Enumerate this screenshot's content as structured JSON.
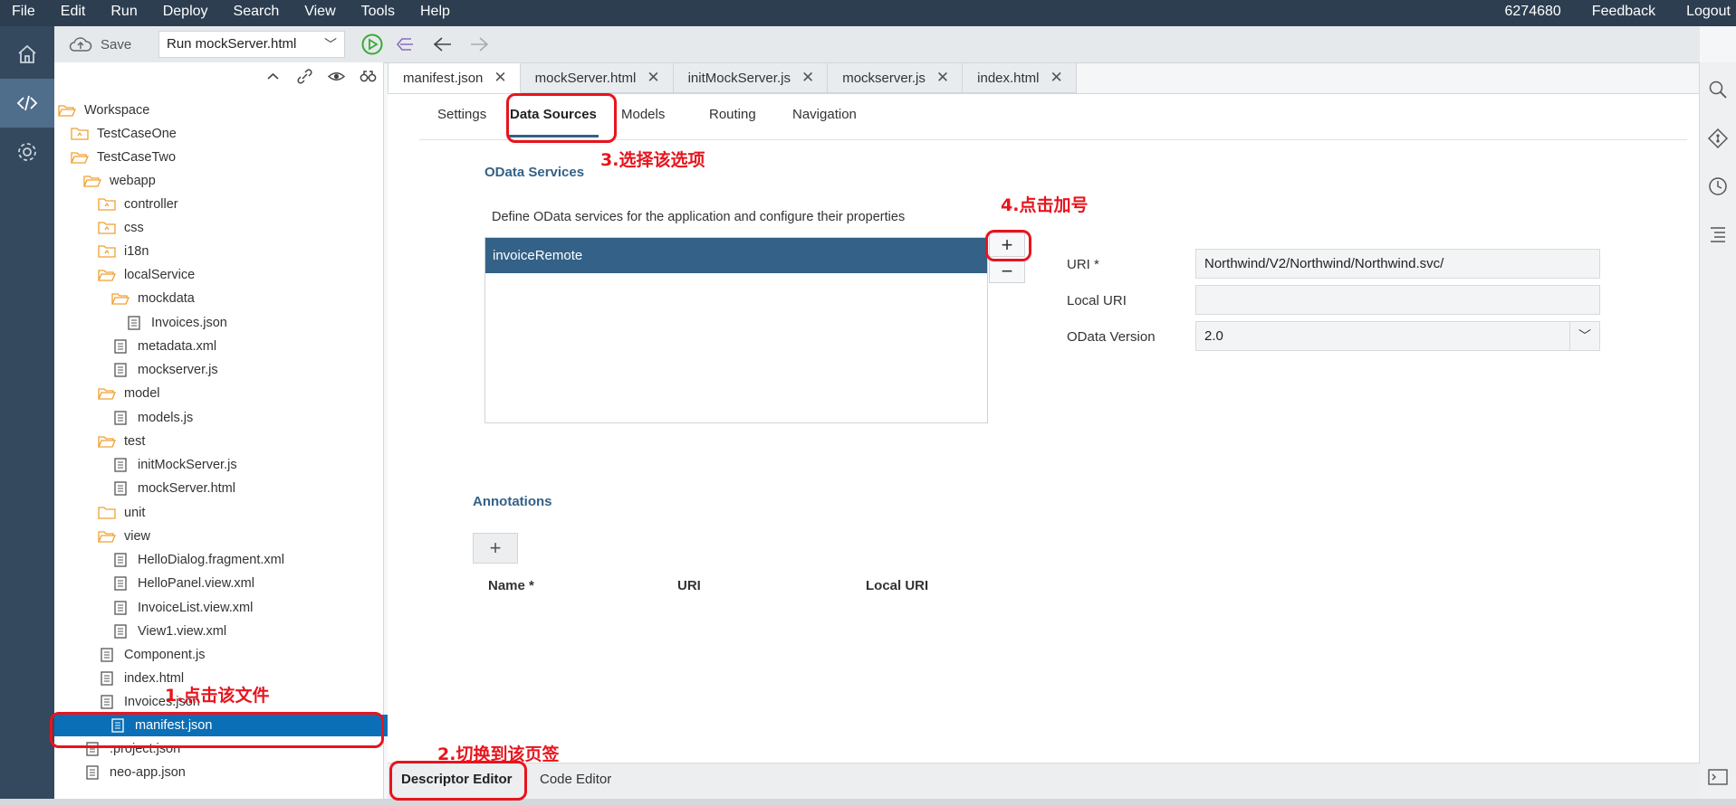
{
  "menubar": {
    "items": [
      "File",
      "Edit",
      "Run",
      "Deploy",
      "Search",
      "View",
      "Tools",
      "Help"
    ],
    "user": "6274680",
    "feedback": "Feedback",
    "logout": "Logout"
  },
  "toolbar": {
    "save_label": "Save",
    "run_config": "Run mockServer.html"
  },
  "explorer": {
    "tree": [
      {
        "label": "Workspace",
        "type": "folder-open",
        "indent": 0
      },
      {
        "label": "TestCaseOne",
        "type": "project",
        "indent": 1
      },
      {
        "label": "TestCaseTwo",
        "type": "folder-open",
        "indent": 1
      },
      {
        "label": "webapp",
        "type": "folder-open",
        "indent": 2
      },
      {
        "label": "controller",
        "type": "project",
        "indent": 3
      },
      {
        "label": "css",
        "type": "project",
        "indent": 3
      },
      {
        "label": "i18n",
        "type": "project",
        "indent": 3
      },
      {
        "label": "localService",
        "type": "folder-open",
        "indent": 3
      },
      {
        "label": "mockdata",
        "type": "folder-open",
        "indent": 4
      },
      {
        "label": "Invoices.json",
        "type": "file",
        "indent": 5
      },
      {
        "label": "metadata.xml",
        "type": "file",
        "indent": 4
      },
      {
        "label": "mockserver.js",
        "type": "file",
        "indent": 4
      },
      {
        "label": "model",
        "type": "folder-open",
        "indent": 3
      },
      {
        "label": "models.js",
        "type": "file",
        "indent": 4
      },
      {
        "label": "test",
        "type": "folder-open",
        "indent": 3
      },
      {
        "label": "initMockServer.js",
        "type": "file",
        "indent": 4
      },
      {
        "label": "mockServer.html",
        "type": "file",
        "indent": 4
      },
      {
        "label": "unit",
        "type": "folder",
        "indent": 3
      },
      {
        "label": "view",
        "type": "folder-open",
        "indent": 3
      },
      {
        "label": "HelloDialog.fragment.xml",
        "type": "file",
        "indent": 4
      },
      {
        "label": "HelloPanel.view.xml",
        "type": "file",
        "indent": 4
      },
      {
        "label": "InvoiceList.view.xml",
        "type": "file",
        "indent": 4
      },
      {
        "label": "View1.view.xml",
        "type": "file",
        "indent": 4
      },
      {
        "label": "Component.js",
        "type": "file",
        "indent": 3
      },
      {
        "label": "index.html",
        "type": "file",
        "indent": 3
      },
      {
        "label": "Invoices.json",
        "type": "file",
        "indent": 3
      },
      {
        "label": "manifest.json",
        "type": "file",
        "indent": 3,
        "selected": true
      },
      {
        "label": ".project.json",
        "type": "file",
        "indent": 2
      },
      {
        "label": "neo-app.json",
        "type": "file",
        "indent": 2
      }
    ]
  },
  "editor_tabs": [
    {
      "label": "manifest.json",
      "active": true
    },
    {
      "label": "mockServer.html"
    },
    {
      "label": "initMockServer.js"
    },
    {
      "label": "mockserver.js"
    },
    {
      "label": "index.html"
    }
  ],
  "descriptor": {
    "subtabs": [
      "Settings",
      "Data Sources",
      "Models",
      "Routing",
      "Navigation"
    ],
    "odata_title": "OData Services",
    "odata_desc": "Define OData services for the application and configure their properties",
    "services": [
      "invoiceRemote"
    ],
    "add_label": "+",
    "remove_label": "−",
    "uri_label": "URI *",
    "uri_value": "Northwind/V2/Northwind/Northwind.svc/",
    "local_uri_label": "Local URI",
    "local_uri_value": "",
    "version_label": "OData Version",
    "version_value": "2.0",
    "annotations_title": "Annotations",
    "annotations_add": "+",
    "columns": [
      "Name *",
      "URI",
      "Local URI"
    ]
  },
  "bottom_tabs": [
    "Descriptor Editor",
    "Code Editor"
  ],
  "annotations": {
    "step1": "1.点击该文件",
    "step2": "2.切换到该页签",
    "step3": "3.选择该选项",
    "step4": "4.点击加号"
  }
}
